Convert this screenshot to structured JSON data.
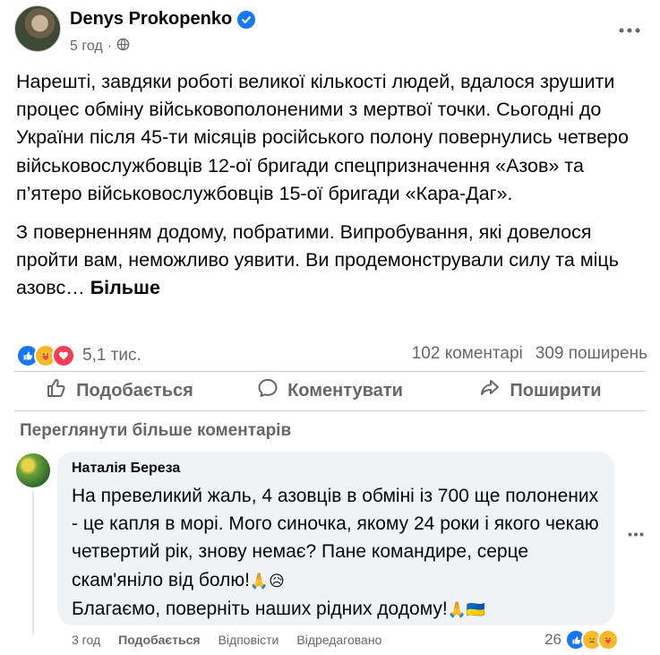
{
  "post": {
    "author": "Denys Prokopenko",
    "time": "5 год",
    "paragraphs": [
      "Нарешті, завдяки роботі великої кількості людей, вдалося зрушити процес обміну військовополоненими з мертвої точки. Сьогодні до України після 45-ти місяців російського полону повернулись четверо військовослужбовців 12-ої бригади спецпризначення «Азов» та п’ятеро військовослужбовців 15-ої бригади «Кара-Даг».",
      "З поверненням додому, побратими. Випробування, які довелося пройти вам, неможливо уявити. Ви продемонстрували силу та міць азовс…"
    ],
    "see_more": "Більше",
    "reaction_count": "5,1 тис.",
    "comments_count": "102 коментарі",
    "shares_count": "309 поширень",
    "actions": {
      "like": "Подобається",
      "comment": "Коментувати",
      "share": "Поширити"
    },
    "view_more_comments": "Переглянути більше коментарів"
  },
  "comment": {
    "author": "Наталія Береза",
    "text_main": "На превеликий жаль, 4 азовців в обміні із 700 ще полонених - це капля в морі. Мого синочка, якому 24 роки і якого чекаю четвертий рік, знову немає? Пане командире, серце скам'яніло від болю!",
    "text_emoji1": "🙏😥",
    "text_line2": "Благаємо, поверніть наших рідних додому!",
    "text_emoji2": "🙏🇺🇦",
    "time": "3 год",
    "like": "Подобається",
    "reply": "Відповісти",
    "edited": "Відредаговано",
    "reaction_count": "26"
  },
  "colors": {
    "accent": "#1877f2",
    "secondary_text": "#65676b",
    "bubble": "#f0f2f5"
  },
  "icons": [
    "verified-badge-icon",
    "globe-icon",
    "more-options-icon",
    "like-reaction-icon",
    "care-reaction-icon",
    "love-reaction-icon",
    "thumbs-up-icon",
    "comment-icon",
    "share-icon"
  ]
}
